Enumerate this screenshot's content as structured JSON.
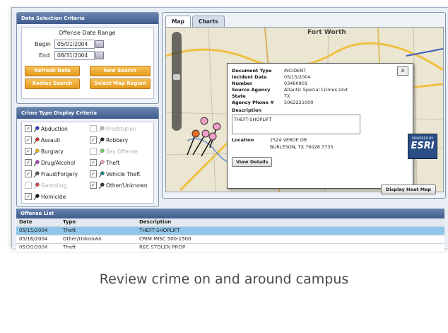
{
  "data_selection": {
    "title": "Data Selection Criteria",
    "subtitle": "Offense Date Range",
    "begin_label": "Begin",
    "begin_value": "05/01/2004",
    "end_label": "End",
    "end_value": "08/31/2004",
    "buttons": {
      "refresh": "Refresh Data",
      "new_search": "New Search",
      "radius": "Radius Search",
      "map_region": "Select Map Region"
    }
  },
  "crime_types": {
    "title": "Crime Type Display Criteria",
    "items": [
      {
        "label": "Abduction",
        "checked": true,
        "enabled": true,
        "color": "#2b3fc4"
      },
      {
        "label": "Prostitution",
        "checked": false,
        "enabled": false,
        "color": "#bbbbbb"
      },
      {
        "label": "Assault",
        "checked": true,
        "enabled": true,
        "color": "#d93030"
      },
      {
        "label": "Robbery",
        "checked": true,
        "enabled": true,
        "color": "#222222"
      },
      {
        "label": "Burglary",
        "checked": true,
        "enabled": true,
        "color": "#e8c020"
      },
      {
        "label": "Sex Offense",
        "checked": false,
        "enabled": false,
        "color": "#6fd06f"
      },
      {
        "label": "Drug/Alcohol",
        "checked": true,
        "enabled": true,
        "color": "#b040c0"
      },
      {
        "label": "Theft",
        "checked": true,
        "enabled": true,
        "color": "#f2a0c8"
      },
      {
        "label": "Fraud/Forgery",
        "checked": true,
        "enabled": true,
        "color": "#555555"
      },
      {
        "label": "Vehicle Theft",
        "checked": true,
        "enabled": true,
        "color": "#1a8a8a"
      },
      {
        "label": "Gambling",
        "checked": false,
        "enabled": false,
        "color": "#e05050"
      },
      {
        "label": "Other/Unknown",
        "checked": true,
        "enabled": true,
        "color": "#333333"
      },
      {
        "label": "Homicide",
        "checked": true,
        "enabled": true,
        "color": "#111111"
      }
    ]
  },
  "map": {
    "tabs": [
      "Map",
      "Charts"
    ],
    "city_label": "Fort Worth",
    "popup": {
      "fields": [
        {
          "label": "Document Type",
          "value": "INCIDENT"
        },
        {
          "label": "Incident Date",
          "value": "05/15/2004"
        },
        {
          "label": "Number",
          "value": "03460901"
        },
        {
          "label": "Source Agency",
          "value": "Atlantic Special Crimes Unit"
        },
        {
          "label": "State",
          "value": "TX"
        },
        {
          "label": "Agency Phone #",
          "value": "5062221000"
        }
      ],
      "description_label": "Description",
      "description": "THEFT-SHOPLIFT",
      "location_label": "Location",
      "location_line1": "2524 VERDE DR",
      "location_line2": "BURLESON, TX 76028 7735",
      "view_details": "View Details",
      "close": "x"
    },
    "esri_top": "POWERED BY",
    "esri_brand": "ESRI",
    "heat_map_button": "Display Heat Map"
  },
  "offense_list": {
    "title": "Offense List",
    "columns": [
      "Date",
      "Type",
      "Description"
    ],
    "rows": [
      [
        "05/15/2004",
        "Theft",
        "THEFT-SHOPLIFT"
      ],
      [
        "05/16/2004",
        "Other/Unknown",
        "CRIM MISC 500-1500"
      ],
      [
        "05/20/2004",
        "Theft",
        "REC STOLEN PROP"
      ]
    ]
  },
  "caption": "Review crime on and around campus"
}
